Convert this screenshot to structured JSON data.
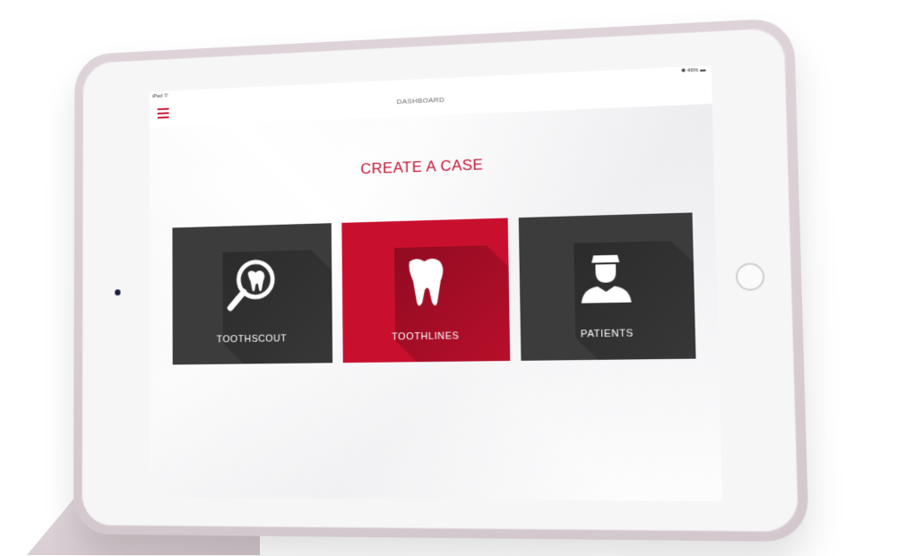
{
  "statusbar": {
    "carrier": "iPad ᯤ",
    "battery": "✱ 46% ▬"
  },
  "header": {
    "title": "DASHBOARD",
    "menu_icon": "hamburger-menu-icon"
  },
  "main": {
    "heading": "CREATE A CASE",
    "tiles": [
      {
        "label": "TOOTHSCOUT",
        "icon": "magnifier-tooth-icon",
        "color": "#3d3c3d"
      },
      {
        "label": "TOOTHLINES",
        "icon": "tooth-icon",
        "color": "#c8102e"
      },
      {
        "label": "PATIENTS",
        "icon": "patient-icon",
        "color": "#3d3c3d"
      }
    ]
  },
  "colors": {
    "accent": "#c4122f",
    "tile_dark": "#3d3c3d",
    "tile_red": "#c8102e"
  }
}
